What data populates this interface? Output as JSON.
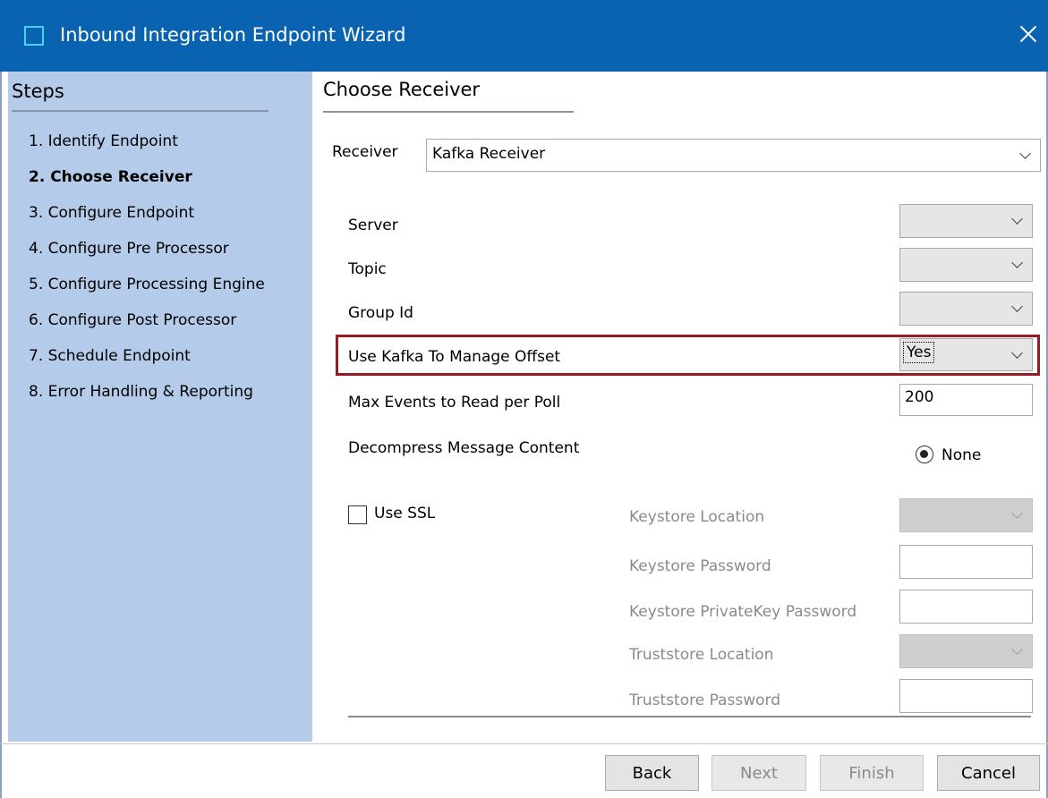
{
  "window": {
    "title": "Inbound Integration Endpoint Wizard"
  },
  "steps": {
    "title": "Steps",
    "items": [
      {
        "label": "1. Identify Endpoint"
      },
      {
        "label": "2. Choose Receiver"
      },
      {
        "label": "3. Configure Endpoint"
      },
      {
        "label": "4. Configure Pre Processor"
      },
      {
        "label": "5. Configure Processing Engine"
      },
      {
        "label": "6. Configure Post Processor"
      },
      {
        "label": "7. Schedule Endpoint"
      },
      {
        "label": "8. Error Handling & Reporting"
      }
    ],
    "active_index": 1
  },
  "main": {
    "title": "Choose Receiver",
    "receiver": {
      "label": "Receiver",
      "value": "Kafka Receiver"
    },
    "fields": {
      "server": {
        "label": "Server",
        "value": ""
      },
      "topic": {
        "label": "Topic",
        "value": ""
      },
      "group_id": {
        "label": "Group Id",
        "value": ""
      },
      "manage_offset": {
        "label": "Use Kafka To Manage Offset",
        "value": "Yes"
      },
      "max_events": {
        "label": "Max Events to Read per Poll",
        "value": "200"
      },
      "decompress": {
        "label": "Decompress Message Content",
        "option": "None"
      }
    },
    "ssl": {
      "checkbox_label": "Use SSL",
      "keystore_location": {
        "label": "Keystore Location",
        "value": ""
      },
      "keystore_password": {
        "label": "Keystore Password",
        "value": ""
      },
      "keystore_privatekey_password": {
        "label": "Keystore PrivateKey Password",
        "value": ""
      },
      "truststore_location": {
        "label": "Truststore Location",
        "value": ""
      },
      "truststore_password": {
        "label": "Truststore Password",
        "value": ""
      }
    }
  },
  "footer": {
    "back_label": "Back",
    "next_label": "Next",
    "finish_label": "Finish",
    "cancel_label": "Cancel"
  },
  "colors": {
    "titlebar": "#0a63b1",
    "steps_panel": "#b4ccea",
    "highlight": "#9b1c20"
  }
}
